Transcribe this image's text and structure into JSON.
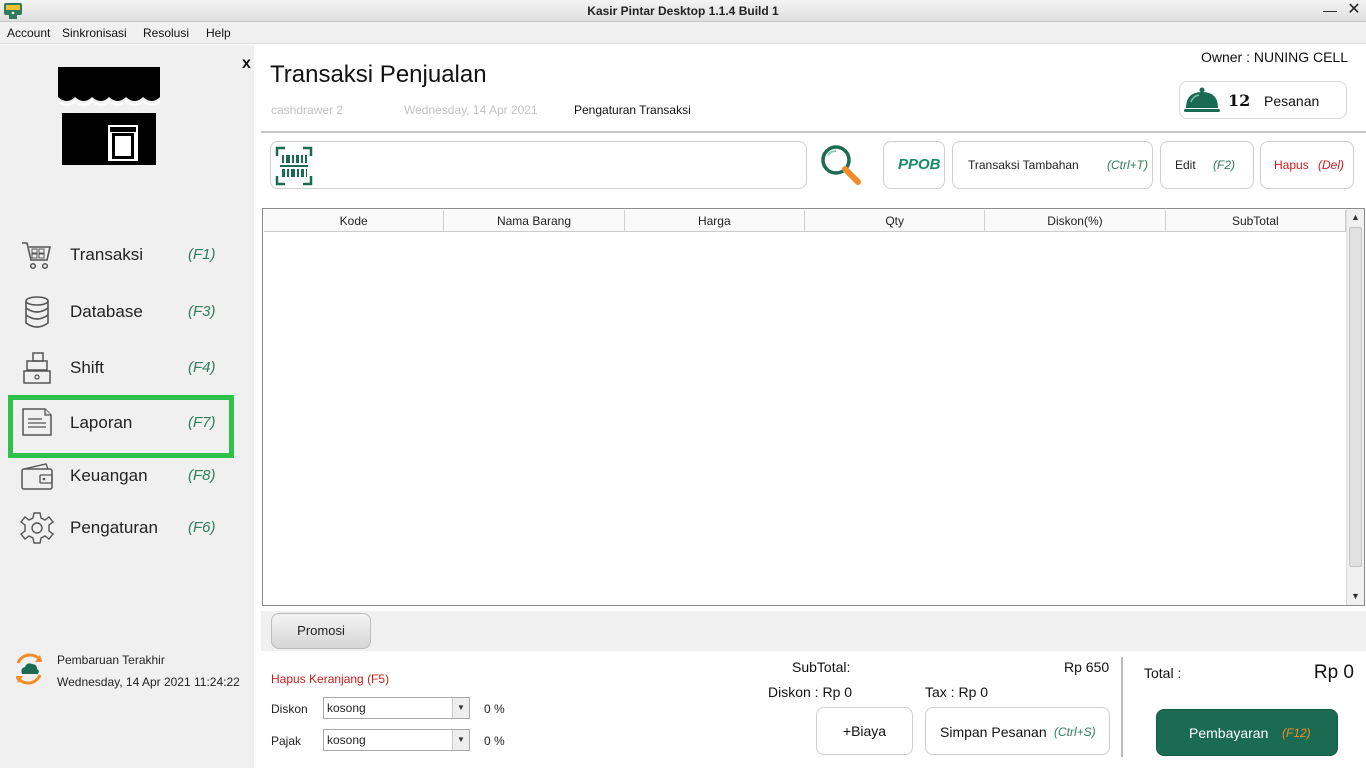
{
  "window": {
    "title": "Kasir Pintar Desktop 1.1.4  Build 1",
    "minimize": "—",
    "close": "✕"
  },
  "menu": {
    "items": [
      "Account",
      "Sinkronisasi",
      "Resolusi",
      "Help"
    ]
  },
  "sidebar": {
    "close_label": "x",
    "items": [
      {
        "label": "Transaksi",
        "key": "(F1)",
        "icon": "shopping-cart-icon"
      },
      {
        "label": "Database",
        "key": "(F3)",
        "icon": "database-icon"
      },
      {
        "label": "Shift",
        "key": "(F4)",
        "icon": "cash-register-icon"
      },
      {
        "label": "Laporan",
        "key": "(F7)",
        "icon": "document-icon"
      },
      {
        "label": "Keuangan",
        "key": "(F8)",
        "icon": "wallet-icon"
      },
      {
        "label": "Pengaturan",
        "key": "(F6)",
        "icon": "gear-icon"
      }
    ],
    "active_index": 3,
    "sync": {
      "title": "Pembaruan Terakhir",
      "time": "Wednesday, 14 Apr 2021 11:24:22"
    }
  },
  "header": {
    "title": "Transaksi Penjualan",
    "owner": "Owner : NUNING CELL",
    "cashdrawer": "cashdrawer 2",
    "date": "Wednesday, 14 Apr 2021",
    "settings_link": "Pengaturan Transaksi",
    "orders": {
      "count": "12",
      "label": "Pesanan"
    }
  },
  "toolbar": {
    "search_placeholder": "",
    "ppob": "PPOB",
    "extra": {
      "label": "Transaksi Tambahan",
      "key": "(Ctrl+T)"
    },
    "edit": {
      "label": "Edit",
      "key": "(F2)"
    },
    "delete": {
      "label": "Hapus",
      "key": "(Del)"
    }
  },
  "table": {
    "columns": [
      "Kode",
      "Nama Barang",
      "Harga",
      "Qty",
      "Diskon(%)",
      "SubTotal"
    ],
    "rows": []
  },
  "promo": {
    "label": "Promosi"
  },
  "cart": {
    "clear": "Hapus Keranjang (F5)",
    "discount_label": "Diskon",
    "discount_value": "kosong",
    "discount_pct": "0 %",
    "tax_label": "Pajak",
    "tax_value": "kosong",
    "tax_pct": "0 %"
  },
  "summary": {
    "subtotal_label": "SubTotal:",
    "subtotal_value": "Rp 650",
    "discount": "Diskon : Rp 0",
    "tax": "Tax : Rp 0",
    "biaya": "+Biaya",
    "save": {
      "label": "Simpan Pesanan",
      "key": "(Ctrl+S)"
    },
    "total_label": "Total :",
    "total_value": "Rp 0",
    "pay": {
      "label": "Pembayaran",
      "key": "(F12)"
    }
  },
  "colors": {
    "brand_green": "#1b6b52",
    "active_outline": "#2ec24a",
    "danger": "#d21a1a",
    "accent_orange": "#f28c28"
  }
}
